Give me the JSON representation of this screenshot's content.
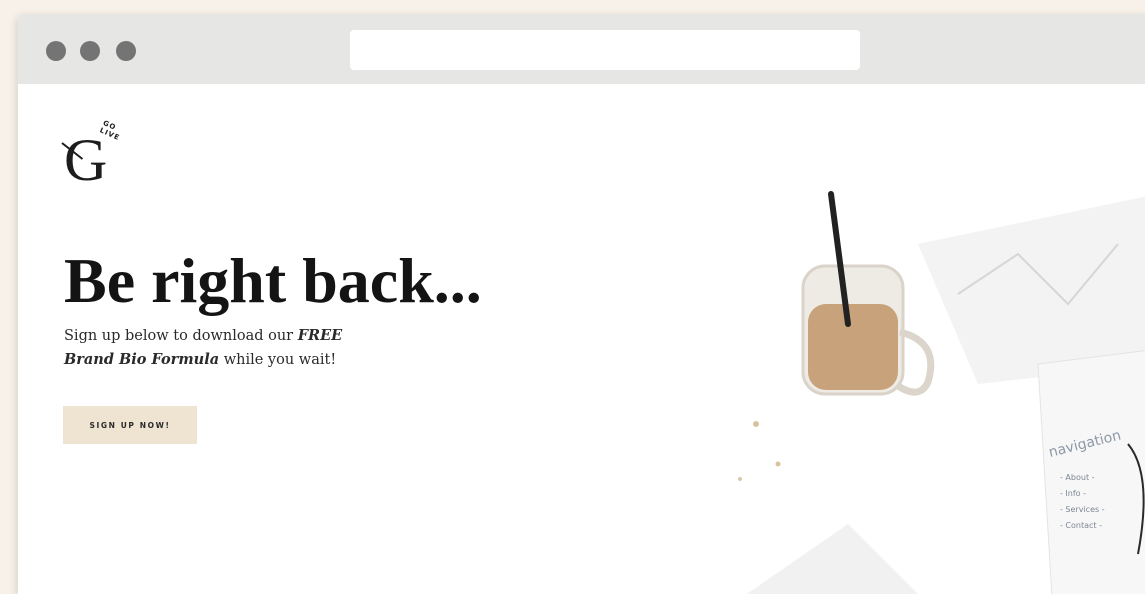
{
  "browser": {
    "window_controls": [
      "control-dot",
      "control-dot",
      "control-dot"
    ]
  },
  "page": {
    "logo": {
      "letter": "G",
      "tagline": "GO LIVE"
    },
    "headline": "Be right back...",
    "subtext": {
      "part1": "Sign up below to download our ",
      "emphasis1": "FREE",
      "emphasis2": "Brand Bio Formula",
      "part2": " while you wait!"
    },
    "cta_label": "SIGN UP NOW!",
    "photo": {
      "sketch_title": "navigation",
      "sketch_items": [
        "- About -",
        "- Info -",
        "- Services -",
        "- Contact -"
      ]
    }
  },
  "colors": {
    "backdrop": "#f7f1ea",
    "chrome": "#e6e7e5",
    "dots": "#747474",
    "cta_bg": "#efe3d2",
    "text": "#141414"
  }
}
